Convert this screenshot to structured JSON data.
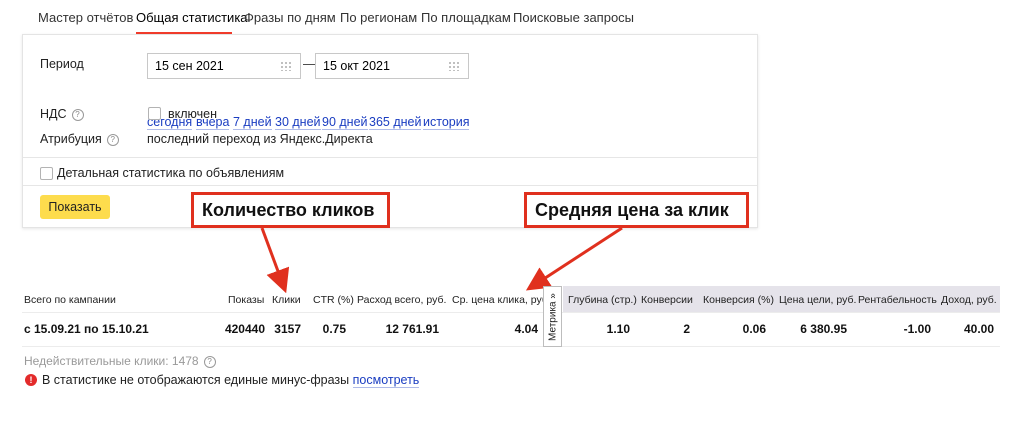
{
  "tabs": [
    "Мастер отчётов",
    "Общая статистика",
    "Фразы по дням",
    "По регионам",
    "По площадкам",
    "Поисковые запросы"
  ],
  "active_tab": "Общая статистика",
  "form": {
    "period_label": "Период",
    "date_from": "15 сен 2021",
    "date_separator": "—",
    "date_to": "15 окт 2021",
    "quick_ranges": [
      "сегодня",
      "вчера",
      "7 дней",
      "30 дней",
      "90 дней",
      "365 дней",
      "история"
    ],
    "vat_label": "НДС",
    "vat_checkbox_label": "включен",
    "attribution_label": "Атрибуция",
    "attribution_value": "последний переход из Яндекс.Директа",
    "detailed_stats_label": "Детальная статистика по объявлениям",
    "show_button": "Показать",
    "help_glyph": "?"
  },
  "annotations": {
    "clicks_callout": "Количество кликов",
    "cpc_callout": "Средняя цена за клик",
    "arrow_color": "#e0301e"
  },
  "table": {
    "headers": [
      "Всего по кампании",
      "Показы",
      "Клики",
      "CTR (%)",
      "Расход всего, руб.",
      "Ср. цена клика, руб.",
      "Глубина (стр.)",
      "Конверсии",
      "Конверсия (%)",
      "Цена цели, руб.",
      "Рентабельность",
      "Доход, руб."
    ],
    "row": [
      "с 15.09.21 по 15.10.21",
      "420440",
      "3157",
      "0.75",
      "12 761.91",
      "4.04",
      "1.10",
      "2",
      "0.06",
      "6 380.95",
      "-1.00",
      "40.00"
    ],
    "metrika_tab": "Метрика »"
  },
  "footer": {
    "invalid_clicks": "Недействительные клики: 1478",
    "warning_icon": "!",
    "warning_text": "В статистике не отображаются единые минус-фразы ",
    "warning_link": "посмотреть"
  },
  "colors": {
    "accent_red": "#f23c2c",
    "button_yellow": "#fddc4d",
    "link_blue": "#1a3dc1",
    "header_lilac": "#e5e3ea"
  }
}
